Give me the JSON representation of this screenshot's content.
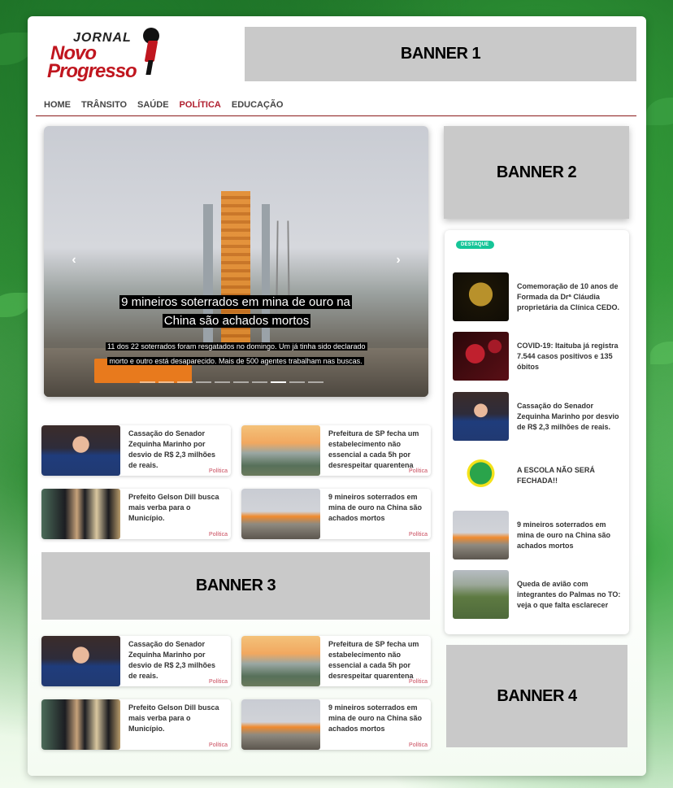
{
  "header": {
    "logo": {
      "line1": "JORNAL",
      "line2": "Novo",
      "line3": "Progresso"
    },
    "banner1": "BANNER 1"
  },
  "nav": {
    "items": [
      {
        "label": "HOME",
        "active": false
      },
      {
        "label": "TRÂNSITO",
        "active": false
      },
      {
        "label": "SAÚDE",
        "active": false
      },
      {
        "label": "POLÍTICA",
        "active": true
      },
      {
        "label": "EDUCAÇÃO",
        "active": false
      }
    ]
  },
  "slider": {
    "title": "9 mineiros soterrados em mina de ouro na China são achados mortos",
    "summary": "11 dos 22 soterrados foram resgatados no domingo. Um já tinha sido declarado morto e outro está desaparecido. Mais de 500 agentes trabalham nas buscas.",
    "prev_icon": "chevron-left-icon",
    "next_icon": "chevron-right-icon",
    "slide_count": 10,
    "active_slide": 8
  },
  "news_top": [
    {
      "title": "Cassação do Senador Zequinha Marinho por desvio de R$ 2,3 milhões de reais.",
      "category": "Política",
      "image": "senator-portrait"
    },
    {
      "title": "Prefeitura de SP fecha um estabelecimento não essencial a cada 5h por desrespeitar quarentena",
      "category": "Política",
      "image": "sao-paulo-bridge"
    },
    {
      "title": "Prefeito Gelson Dill busca mais verba para o Município.",
      "category": "Política",
      "image": "three-men-photo"
    },
    {
      "title": "9 mineiros soterrados em mina de ouro na China são achados mortos",
      "category": "Política",
      "image": "mine-tower"
    }
  ],
  "banner3": "BANNER 3",
  "news_bottom": [
    {
      "title": "Cassação do Senador Zequinha Marinho por desvio de R$ 2,3 milhões de reais.",
      "category": "Política",
      "image": "senator-portrait"
    },
    {
      "title": "Prefeitura de SP fecha um estabelecimento não essencial a cada 5h por desrespeitar quarentena",
      "category": "Política",
      "image": "sao-paulo-bridge"
    },
    {
      "title": "Prefeito Gelson Dill busca mais verba para o Município.",
      "category": "Política",
      "image": "three-men-photo"
    },
    {
      "title": "9 mineiros soterrados em mina de ouro na China são achados mortos",
      "category": "Política",
      "image": "mine-tower"
    }
  ],
  "sidebar": {
    "banner2": "BANNER 2",
    "badge": "DESTAQUE",
    "items": [
      {
        "title": "Comemoração de 10 anos de Formada da Drª Cláudia proprietária da Clínica CEDO.",
        "image": "10-years-card"
      },
      {
        "title": "COVID-19: Itaituba já registra 7.544 casos positivos e 135 óbitos",
        "image": "virus"
      },
      {
        "title": "Cassação do Senador Zequinha Marinho por desvio de R$ 2,3 milhões de reais.",
        "image": "senator-portrait"
      },
      {
        "title": "A ESCOLA NÃO SERÁ FECHADA!!",
        "image": "school-logo"
      },
      {
        "title": "9 mineiros soterrados em mina de ouro na China são achados mortos",
        "image": "mine-tower"
      },
      {
        "title": "Queda de avião com integrantes do Palmas no TO: veja o que falta esclarecer",
        "image": "plane-crash"
      }
    ],
    "banner4": "BANNER 4"
  },
  "colors": {
    "brand_red": "#c0161f",
    "nav_active": "#b01e2e",
    "badge": "#16c598",
    "banner_gray": "#c9c9c9",
    "category": "#c9495b"
  }
}
